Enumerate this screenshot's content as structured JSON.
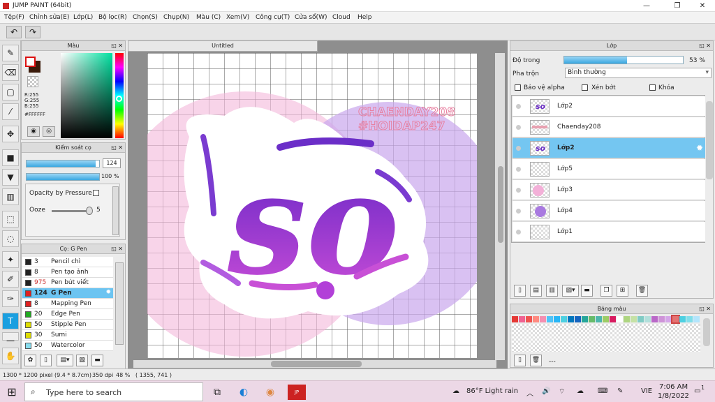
{
  "window": {
    "title": "JUMP PAINT (64bit)",
    "minimize": "—",
    "maximize": "❐",
    "close": "✕"
  },
  "menu": [
    "Tệp(F)",
    "Chỉnh sửa(E)",
    "Lớp(L)",
    "Bộ lọc(R)",
    "Chọn(S)",
    "Chụp(N)",
    "Màu (C)",
    "Xem(V)",
    "Công cụ(T)",
    "Cửa sổ(W)",
    "Cloud",
    "Help"
  ],
  "toolbar": {
    "undo": "↶",
    "redo": "↷"
  },
  "color_panel": {
    "title": "Màu",
    "r": "R:255",
    "g": "G:255",
    "b": "B:255",
    "hex": "#FFFFFF",
    "primary_color": "#ffffff",
    "secondary_color": "#3a1a0a"
  },
  "brush_control": {
    "title": "Kiểm soát cọ",
    "size_value": "124",
    "size_fraction": 0.95,
    "opacity_value": "100 %",
    "opacity_fraction": 1.0,
    "opacity_by_pressure_label": "Opacity by Pressure",
    "ooze_label": "Ooze",
    "ooze_value": "5"
  },
  "brush_list": {
    "title": "Cọ: G Pen",
    "items": [
      {
        "num": "3",
        "name": "Pencil chì",
        "color": "#222222"
      },
      {
        "num": "8",
        "name": "Pen tạo ảnh",
        "color": "#222222"
      },
      {
        "num": "975",
        "name": "Pen bút viết",
        "color": "#222222"
      },
      {
        "num": "124",
        "name": "G Pen",
        "color": "#e02020"
      },
      {
        "num": "8",
        "name": "Mapping Pen",
        "color": "#e02020"
      },
      {
        "num": "20",
        "name": "Edge Pen",
        "color": "#22aa22"
      },
      {
        "num": "50",
        "name": "Stipple Pen",
        "color": "#dddd00"
      },
      {
        "num": "30",
        "name": "Sumi",
        "color": "#dddd00"
      },
      {
        "num": "50",
        "name": "Watercolor",
        "color": "#88ddee"
      }
    ]
  },
  "document": {
    "tab_title": "Untitled",
    "watermark_line1": "CHAENDAY208",
    "watermark_line2": "#HOIDAP247",
    "art_text": "so"
  },
  "layer_panel": {
    "title": "Lớp",
    "opacity_label": "Độ trong",
    "opacity_value": "53 %",
    "opacity_fraction": 0.53,
    "blend_label": "Pha trộn",
    "blend_value": "Bình thường",
    "protect_alpha": "Bảo vệ alpha",
    "clipping": "Xén bớt",
    "lock": "Khóa",
    "layers": [
      {
        "name": "Lớp2",
        "thumb": "art"
      },
      {
        "name": "Chaenday208",
        "thumb": "text"
      },
      {
        "name": "Lớp2",
        "thumb": "art"
      },
      {
        "name": "Lớp5",
        "thumb": "blank"
      },
      {
        "name": "Lớp3",
        "thumb": "pink"
      },
      {
        "name": "Lớp4",
        "thumb": "purple"
      },
      {
        "name": "Lớp1",
        "thumb": "blank"
      }
    ]
  },
  "palette_panel": {
    "title": "Bảng màu",
    "dash": "---"
  },
  "status": {
    "size": "1300 * 1200 pixel",
    "cm": "(9.4 * 8.7cm)",
    "dpi": "350 dpi",
    "zoom": "48 %",
    "coords": "( 1355, 741 )"
  },
  "taskbar": {
    "search_placeholder": "Type here to search",
    "weather": "86°F  Light rain",
    "lang": "VIE",
    "time": "7:06 AM",
    "date": "1/8/2022",
    "notif": "1"
  }
}
